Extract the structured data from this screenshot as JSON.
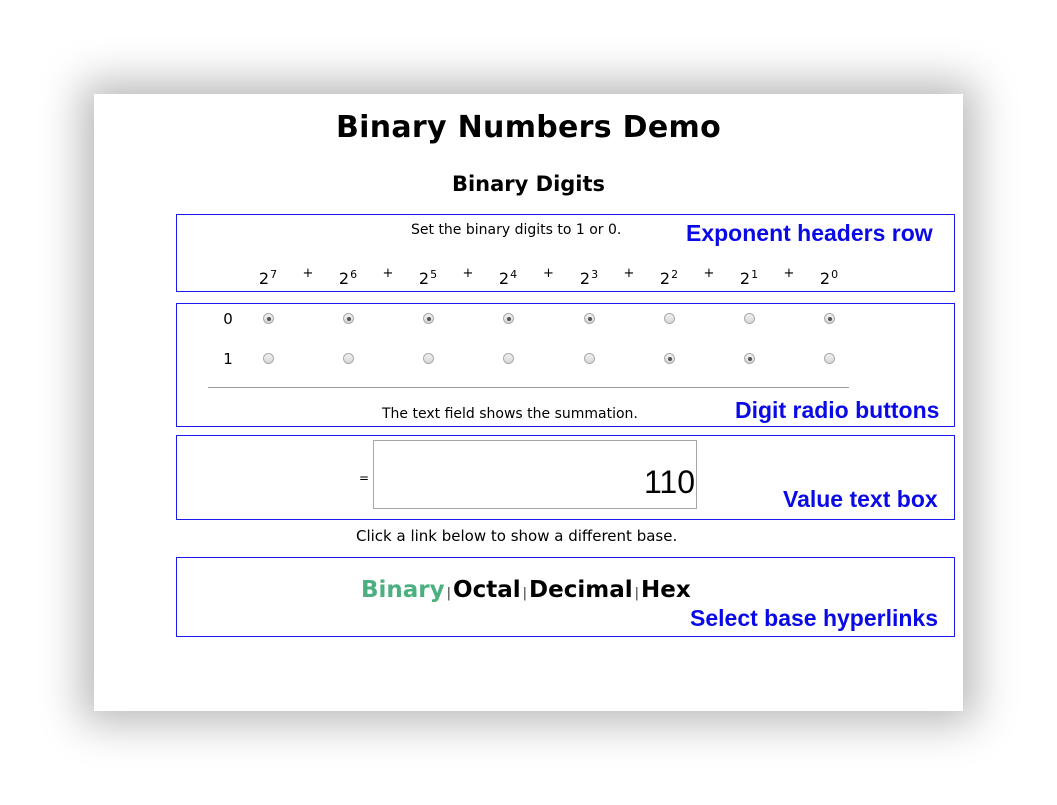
{
  "page": {
    "title": "Binary Numbers Demo",
    "subtitle": "Binary Digits"
  },
  "exponent_row": {
    "instruction": "Set the binary digits to 1 or 0.",
    "base": "2",
    "exponents": [
      "7",
      "6",
      "5",
      "4",
      "3",
      "2",
      "1",
      "0"
    ],
    "operator": "+",
    "annotation": "Exponent headers row"
  },
  "digit_rows": {
    "row_labels": [
      "0",
      "1"
    ],
    "selected_bits": [
      0,
      0,
      0,
      0,
      0,
      1,
      1,
      0
    ],
    "footer_text": "The text field shows the summation.",
    "annotation": "Digit radio buttons"
  },
  "value_box": {
    "equals_label": "=",
    "value": "110",
    "annotation": "Value text box"
  },
  "base_links": {
    "instruction": "Click a link below to show a different base.",
    "links": [
      {
        "label": "Binary",
        "active": true
      },
      {
        "label": "Octal",
        "active": false
      },
      {
        "label": "Decimal",
        "active": false
      },
      {
        "label": "Hex",
        "active": false
      }
    ],
    "separator": "|",
    "annotation": "Select base hyperlinks",
    "active_color": "#4caf80"
  },
  "colors": {
    "annotation": "#0a0ae6",
    "box_border": "#1a1aee"
  }
}
